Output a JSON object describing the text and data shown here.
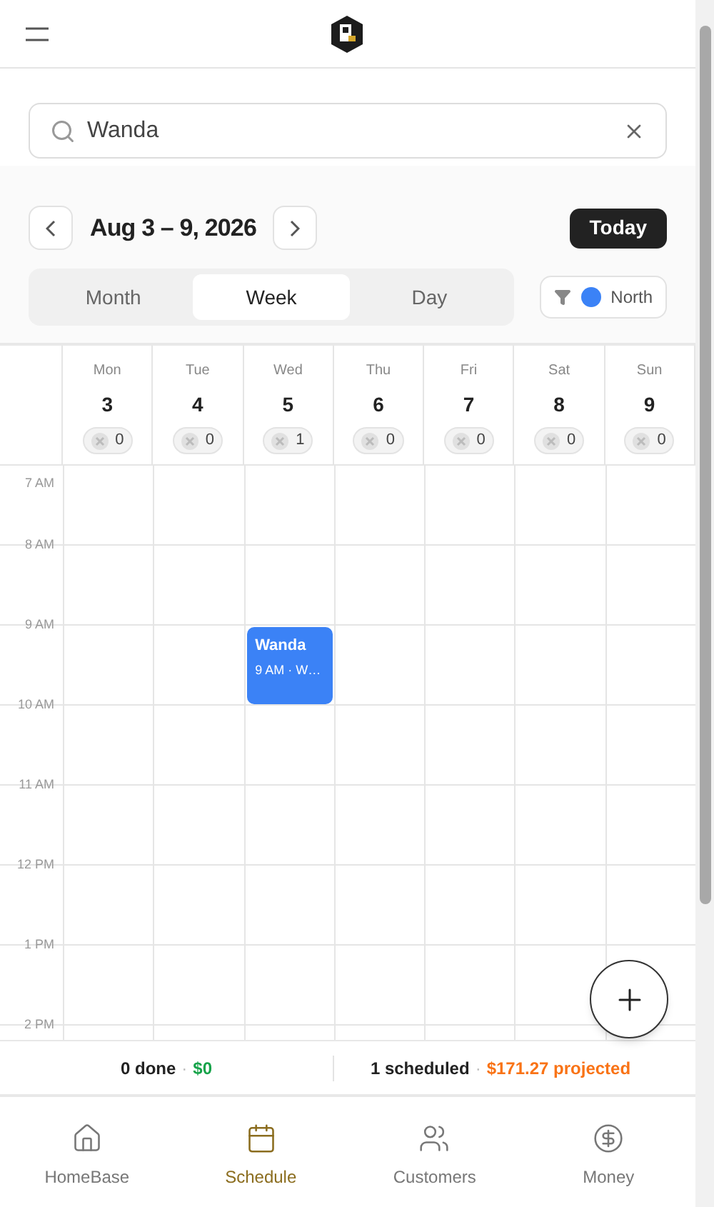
{
  "search": {
    "value": "Wanda"
  },
  "range": {
    "title": "Aug 3 – 9, 2026",
    "today": "Today"
  },
  "view_tabs": [
    {
      "label": "Month",
      "selected": false
    },
    {
      "label": "Week",
      "selected": true
    },
    {
      "label": "Day",
      "selected": false
    }
  ],
  "filter": {
    "label": "North",
    "color": "#3b82f6"
  },
  "days": [
    {
      "name": "Mon",
      "date": "3",
      "count": "0"
    },
    {
      "name": "Tue",
      "date": "4",
      "count": "0"
    },
    {
      "name": "Wed",
      "date": "5",
      "count": "1"
    },
    {
      "name": "Thu",
      "date": "6",
      "count": "0"
    },
    {
      "name": "Fri",
      "date": "7",
      "count": "0"
    },
    {
      "name": "Sat",
      "date": "8",
      "count": "0"
    },
    {
      "name": "Sun",
      "date": "9",
      "count": "0"
    }
  ],
  "hours": [
    {
      "label": "7 AM"
    },
    {
      "label": "8 AM"
    },
    {
      "label": "9 AM",
      "cells": [
        {},
        {},
        {
          "events": [
            {
              "title": "Wanda",
              "subtitle": "9 AM · W…",
              "color": "#3b82f6"
            }
          ]
        }
      ]
    },
    {
      "label": "10 AM"
    },
    {
      "label": "11 AM"
    },
    {
      "label": "12 PM"
    },
    {
      "label": "1 PM"
    },
    {
      "label": "2 PM"
    }
  ],
  "summary": {
    "done": "0 done",
    "done_separator": "·",
    "done_amount": "$0",
    "scheduled": "1 scheduled",
    "scheduled_separator": "·",
    "projected": "$171.27 projected"
  },
  "nav": [
    {
      "kind": "home",
      "label": "HomeBase",
      "selected": false
    },
    {
      "kind": "calendar",
      "label": "Schedule",
      "selected": true
    },
    {
      "kind": "people",
      "label": "Customers",
      "selected": false
    },
    {
      "kind": "money",
      "label": "Money",
      "selected": false
    }
  ]
}
